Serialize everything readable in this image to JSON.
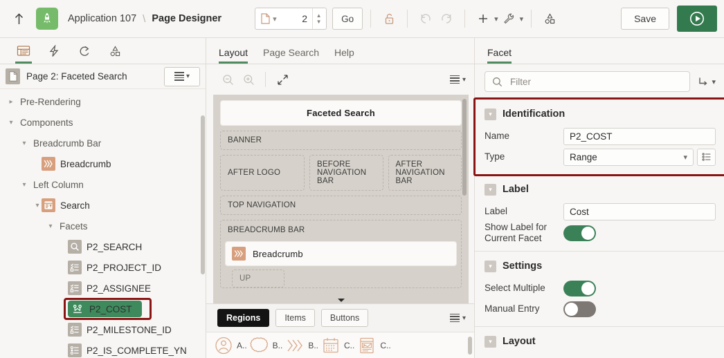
{
  "topbar": {
    "up_icon": "arrow-up-icon",
    "app_logo_icon": "rocket-icon",
    "app_name": "Application 107",
    "separator": "\\",
    "current": "Page Designer",
    "page_icon": "page-icon",
    "page_number": "2",
    "go_label": "Go",
    "lock_icon": "unlock-icon",
    "undo_icon": "undo-icon",
    "redo_icon": "redo-icon",
    "add_icon": "plus-icon",
    "utilities_icon": "wrench-icon",
    "shapes_icon": "shapes-icon",
    "save_label": "Save",
    "run_icon": "play-icon"
  },
  "left": {
    "tabs": [
      {
        "name": "rendering-tab",
        "icon": "page-layout-icon",
        "active": true
      },
      {
        "name": "dynamic-actions-tab",
        "icon": "lightning-icon",
        "active": false
      },
      {
        "name": "processing-tab",
        "icon": "refresh-cycle-icon",
        "active": false
      },
      {
        "name": "page-shared-components-tab",
        "icon": "shapes-icon",
        "active": false
      }
    ],
    "tree_header": {
      "icon": "page-icon",
      "label": "Page 2: Faceted Search",
      "menu_icon": "hamburger-icon",
      "menu_chevron": "chevron-down-icon"
    },
    "tree": [
      {
        "label": "Pre-Rendering",
        "depth": 0,
        "chevron": "right",
        "icon": null,
        "selected": false
      },
      {
        "label": "Components",
        "depth": 0,
        "chevron": "down",
        "icon": null,
        "selected": false
      },
      {
        "label": "Breadcrumb Bar",
        "depth": 1,
        "chevron": "down",
        "icon": null,
        "selected": false
      },
      {
        "label": "Breadcrumb",
        "depth": 2,
        "chevron": "none",
        "icon": "breadcrumb-icon",
        "selected": false
      },
      {
        "label": "Left Column",
        "depth": 1,
        "chevron": "down",
        "icon": null,
        "selected": false
      },
      {
        "label": "Search",
        "depth": 2,
        "chevron": "down",
        "icon": "faceted-search-icon",
        "selected": false
      },
      {
        "label": "Facets",
        "depth": 3,
        "chevron": "down",
        "icon": null,
        "selected": false
      },
      {
        "label": "P2_SEARCH",
        "depth": 4,
        "chevron": "none",
        "icon": "search-icon",
        "selected": false
      },
      {
        "label": "P2_PROJECT_ID",
        "depth": 4,
        "chevron": "none",
        "icon": "checklist-icon",
        "selected": false
      },
      {
        "label": "P2_ASSIGNEE",
        "depth": 4,
        "chevron": "none",
        "icon": "checklist-icon",
        "selected": false
      },
      {
        "label": "P2_COST",
        "depth": 4,
        "chevron": "none",
        "icon": "range-icon",
        "selected": true
      },
      {
        "label": "P2_MILESTONE_ID",
        "depth": 4,
        "chevron": "none",
        "icon": "checklist-icon",
        "selected": false
      },
      {
        "label": "P2_IS_COMPLETE_YN",
        "depth": 4,
        "chevron": "none",
        "icon": "radiolist-icon",
        "selected": false
      }
    ]
  },
  "center": {
    "tabs": [
      {
        "label": "Layout",
        "active": true
      },
      {
        "label": "Page Search",
        "active": false
      },
      {
        "label": "Help",
        "active": false
      }
    ],
    "tools": [
      {
        "name": "zoom-out-icon"
      },
      {
        "name": "zoom-in-icon"
      },
      {
        "name": "expand-icon"
      },
      {
        "name": "hamburger-icon"
      }
    ],
    "grid": {
      "header": "Faceted Search",
      "banner": "BANNER",
      "after_logo": "AFTER LOGO",
      "before_navigation_bar": "BEFORE NAVIGATION BAR",
      "after_navigation_bar": "AFTER NAVIGATION BAR",
      "top_navigation": "TOP NAVIGATION",
      "breadcrumb_bar": "BREADCRUMB BAR",
      "breadcrumb_region": "Breadcrumb",
      "breadcrumb_region_icon": "breadcrumb-icon",
      "up": "UP"
    },
    "bottom": {
      "buttons": [
        {
          "label": "Regions",
          "active": true
        },
        {
          "label": "Items",
          "active": false
        },
        {
          "label": "Buttons",
          "active": false
        }
      ],
      "menu_icon": "hamburger-icon",
      "gallery": [
        {
          "icon": "alert-region-icon",
          "label": "A.."
        },
        {
          "icon": "badge-list-icon",
          "label": "B.."
        },
        {
          "icon": "breadcrumb-icon",
          "label": "B.."
        },
        {
          "icon": "calendar-icon",
          "label": "C.."
        },
        {
          "icon": "cards-icon",
          "label": "C.."
        }
      ]
    }
  },
  "right": {
    "tabs": [
      {
        "label": "Facet",
        "active": true
      }
    ],
    "filter": {
      "placeholder": "Filter",
      "icon": "search-icon",
      "goto_icon": "goto-group-icon",
      "chevron": "chevron-down-icon"
    },
    "groups": [
      {
        "title": "Identification",
        "highlighted": true,
        "rows": [
          {
            "type": "text",
            "label": "Name",
            "value": "P2_COST"
          },
          {
            "type": "select",
            "label": "Type",
            "value": "Range",
            "lov_icon": "list-of-values-icon"
          }
        ]
      },
      {
        "title": "Label",
        "highlighted": false,
        "rows": [
          {
            "type": "text",
            "label": "Label",
            "value": "Cost"
          },
          {
            "type": "toggle",
            "label": "Show Label for Current Facet",
            "value": "on"
          }
        ]
      },
      {
        "title": "Settings",
        "highlighted": false,
        "rows": [
          {
            "type": "toggle",
            "label": "Select Multiple",
            "value": "on"
          },
          {
            "type": "toggle",
            "label": "Manual Entry",
            "value": "off"
          }
        ]
      },
      {
        "title": "Layout",
        "highlighted": false,
        "rows": []
      }
    ]
  },
  "colors": {
    "accent_green": "#337a4e",
    "toggle_on": "#3b8158",
    "toggle_off": "#7d7873",
    "highlight_red": "#8a1313",
    "selected_tree": "#3e8a5c",
    "logo_green": "#76bb6a"
  }
}
